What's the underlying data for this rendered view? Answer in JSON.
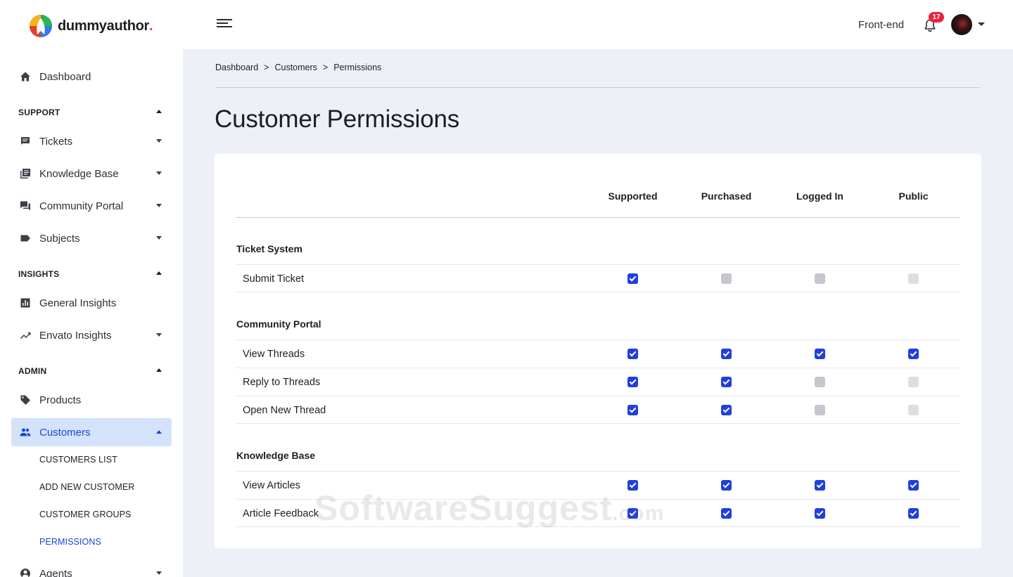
{
  "brand": {
    "name": "dummyauthor",
    "dot": "."
  },
  "sidebar": {
    "dashboard": "Dashboard",
    "sections": {
      "support": "SUPPORT",
      "insights": "INSIGHTS",
      "admin": "ADMIN"
    },
    "items": {
      "tickets": "Tickets",
      "knowledge_base": "Knowledge Base",
      "community_portal": "Community Portal",
      "subjects": "Subjects",
      "general_insights": "General Insights",
      "envato_insights": "Envato Insights",
      "products": "Products",
      "customers": "Customers",
      "agents": "Agents"
    },
    "customers_sub": {
      "list": "CUSTOMERS LIST",
      "add": "ADD NEW CUSTOMER",
      "groups": "CUSTOMER GROUPS",
      "permissions": "PERMISSIONS"
    }
  },
  "topbar": {
    "frontend": "Front-end",
    "notifications": "17"
  },
  "breadcrumb": {
    "items": [
      "Dashboard",
      "Customers",
      "Permissions"
    ],
    "separator": ">"
  },
  "page": {
    "title": "Customer Permissions"
  },
  "table": {
    "columns": [
      "Supported",
      "Purchased",
      "Logged In",
      "Public"
    ],
    "groups": [
      {
        "title": "Ticket System",
        "rows": [
          {
            "label": "Submit Ticket",
            "states": [
              "checked",
              "unchecked",
              "unchecked",
              "disabled"
            ]
          }
        ]
      },
      {
        "title": "Community Portal",
        "rows": [
          {
            "label": "View Threads",
            "states": [
              "checked",
              "checked",
              "checked",
              "checked"
            ]
          },
          {
            "label": "Reply to Threads",
            "states": [
              "checked",
              "checked",
              "unchecked",
              "disabled"
            ]
          },
          {
            "label": "Open New Thread",
            "states": [
              "checked",
              "checked",
              "unchecked",
              "disabled"
            ]
          }
        ]
      },
      {
        "title": "Knowledge Base",
        "rows": [
          {
            "label": "View Articles",
            "states": [
              "checked",
              "checked",
              "checked",
              "checked"
            ]
          },
          {
            "label": "Article Feedback",
            "states": [
              "checked",
              "checked",
              "checked",
              "checked"
            ]
          }
        ]
      }
    ]
  },
  "watermark": {
    "main": "SoftwareSuggest",
    "suffix": ".com"
  },
  "colors": {
    "accent": "#1f3fe0",
    "active_bg": "#d4e3fb",
    "badge": "#e8233e"
  }
}
